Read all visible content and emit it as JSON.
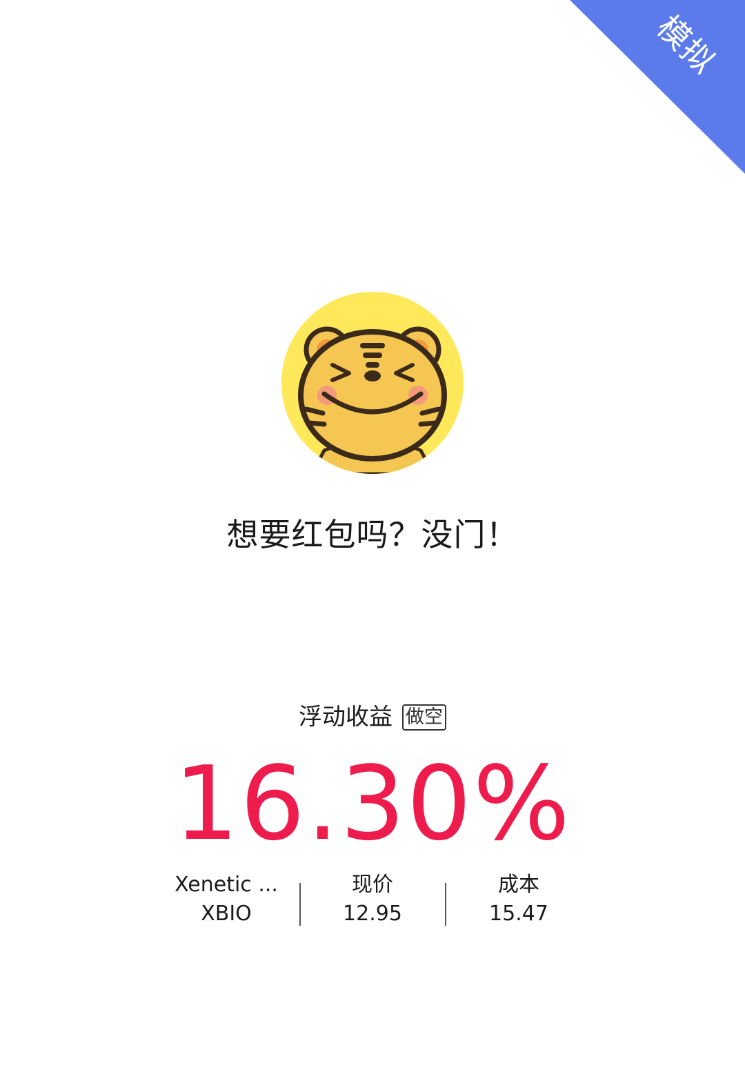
{
  "badge": {
    "label": "模拟",
    "color": "#5b7bea"
  },
  "avatar": {
    "icon": "tiger-face-icon",
    "background": "#ffe95a"
  },
  "headline": "想要红包吗？没门！",
  "pnl": {
    "label": "浮动收益",
    "direction_badge": "做空",
    "value": "16.30%",
    "color": "#ee1c4d"
  },
  "stock": {
    "name": "Xenetic ...",
    "symbol": "XBIO"
  },
  "price": {
    "label": "现价",
    "value": "12.95"
  },
  "cost": {
    "label": "成本",
    "value": "15.47"
  }
}
